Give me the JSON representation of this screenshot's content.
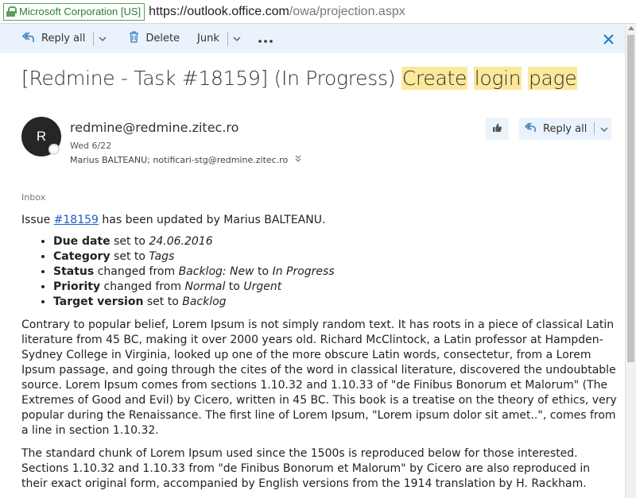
{
  "browser": {
    "cert_label": "Microsoft Corporation [US]",
    "url_base": "https://outlook.office.com",
    "url_path": "/owa/projection.aspx"
  },
  "toolbar": {
    "reply_all": "Reply all",
    "delete": "Delete",
    "junk": "Junk"
  },
  "email": {
    "subject_prefix": "[Redmine - Task #18159] (In Progress) ",
    "subject_words": [
      "Create",
      "login",
      "page"
    ],
    "sender_initial": "R",
    "sender": "redmine@redmine.zitec.ro",
    "date": "Wed 6/22",
    "recipients": "Marius BALTEANU; notificari-stg@redmine.zitec.ro",
    "reply_all_label": "Reply all",
    "folder": "Inbox",
    "intro_before": "Issue ",
    "issue_link": "#18159",
    "intro_after": " has been updated by Marius BALTEANU.",
    "changes": [
      {
        "field": "Due date",
        "t1": " set to ",
        "v1": "24.06.2016",
        "t2": "",
        "v2": ""
      },
      {
        "field": "Category",
        "t1": " set to ",
        "v1": "Tags",
        "t2": "",
        "v2": ""
      },
      {
        "field": "Status",
        "t1": " changed from ",
        "v1": "Backlog: New",
        "t2": " to ",
        "v2": "In Progress"
      },
      {
        "field": "Priority",
        "t1": " changed from ",
        "v1": "Normal",
        "t2": " to ",
        "v2": "Urgent"
      },
      {
        "field": "Target version",
        "t1": " set to ",
        "v1": "Backlog",
        "t2": "",
        "v2": ""
      }
    ],
    "para1": "Contrary to popular belief, Lorem Ipsum is not simply random text. It has roots in a piece of classical Latin literature from 45 BC, making it over 2000 years old. Richard McClintock, a Latin professor at Hampden-Sydney College in Virginia, looked up one of the more obscure Latin words, consectetur, from a Lorem Ipsum passage, and going through the cites of the word in classical literature, discovered the undoubtable source. Lorem Ipsum comes from sections 1.10.32 and 1.10.33 of \"de Finibus Bonorum et Malorum\" (The Extremes of Good and Evil) by Cicero, written in 45 BC. This book is a treatise on the theory of ethics, very popular during the Renaissance. The first line of Lorem Ipsum, \"Lorem ipsum dolor sit amet..\", comes from a line in section 1.10.32.",
    "para2": "The standard chunk of Lorem Ipsum used since the 1500s is reproduced below for those interested. Sections 1.10.32 and 1.10.33 from \"de Finibus Bonorum et Malorum\" by Cicero are also reproduced in their exact original form, accompanied by English versions from the 1914 translation by H. Rackham."
  },
  "icons": {
    "reply_all": "reply-all-icon",
    "delete": "trash-icon",
    "more": "more-icon",
    "close": "close-icon",
    "like": "like-icon"
  },
  "colors": {
    "accent": "#2b7bc0",
    "toolbar_bg": "#eaf3fb",
    "highlight": "#fce89b",
    "link": "#1a5cc7"
  }
}
